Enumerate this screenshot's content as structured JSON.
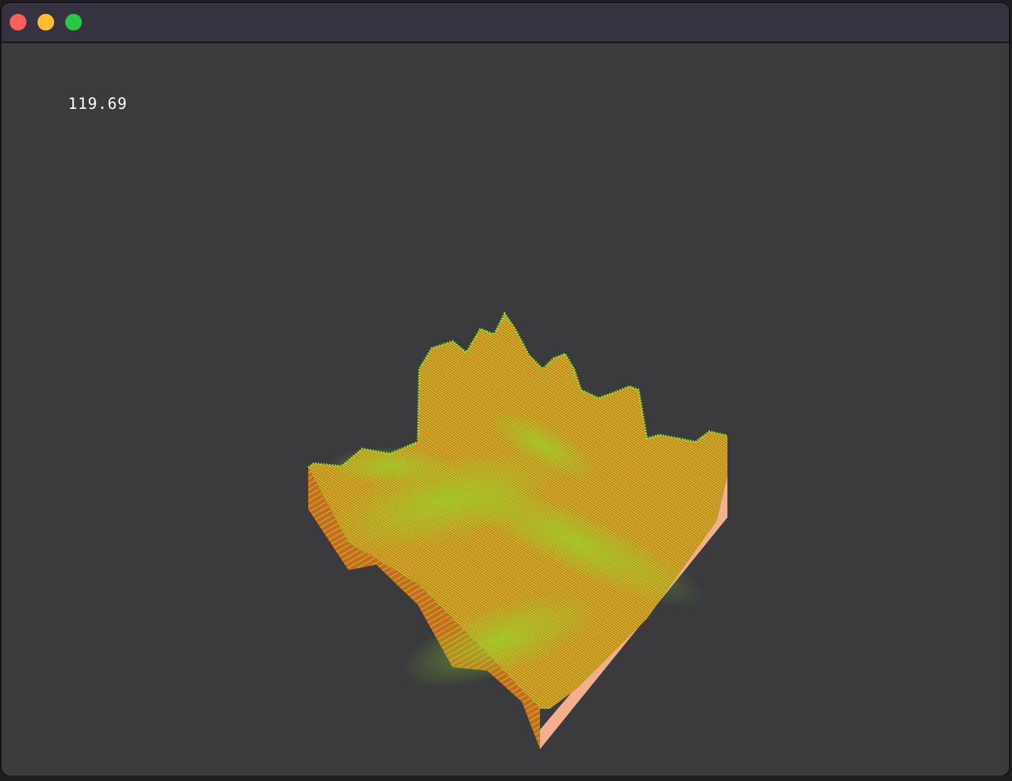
{
  "window": {
    "title": "",
    "controls": {
      "close_color": "#ff5f57",
      "minimize_color": "#febc2e",
      "zoom_color": "#28c840"
    }
  },
  "viewport": {
    "fps_readout": "119.69",
    "background_color": "#3b3b3d",
    "terrain": {
      "top_color_low": "#e8641a",
      "top_color_high": "#8ae62c",
      "front_left_side_color": "#e0702a",
      "front_right_side_color": "#f2b08c"
    }
  }
}
